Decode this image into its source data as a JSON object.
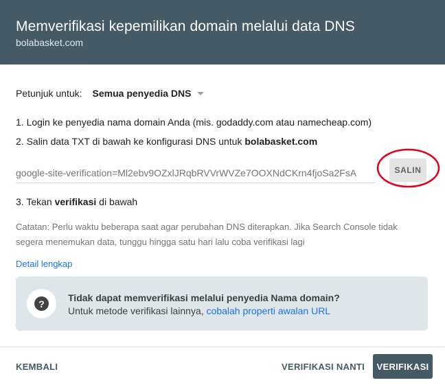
{
  "header": {
    "title": "Memverifikasi kepemilikan domain melalui data DNS",
    "domain": "bolabasket.com"
  },
  "instructions": {
    "label": "Petunjuk untuk:",
    "selected_provider": "Semua penyedia DNS"
  },
  "steps": {
    "step1": "1. Login ke penyedia nama domain Anda (mis. godaddy.com atau namecheap.com)",
    "step2_prefix": "2. Salin data TXT di bawah ke konfigurasi DNS untuk ",
    "step2_domain": "bolabasket.com",
    "step3_prefix": "3. Tekan ",
    "step3_bold": "verifikasi",
    "step3_suffix": " di bawah"
  },
  "txt_record": "google-site-verification=Ml2ebv9OZxlJRqbRVVrWVZe7OOXNdCKrn4fjoSa2FsA",
  "copy_button": "SALIN",
  "note": {
    "line1": "Catatan: Perlu waktu beberapa saat agar perubahan DNS diterapkan. Jika Search Console tidak",
    "line2": "segera menemukan data, tunggu hingga satu hari lalu coba verifikasi lagi"
  },
  "detail_link": "Detail lengkap",
  "help_box": {
    "title": "Tidak dapat memverifikasi melalui penyedia Nama domain?",
    "sub_prefix": "Untuk metode verifikasi lainnya, ",
    "sub_link": "cobalah properti awalan URL"
  },
  "footer": {
    "back": "KEMBALI",
    "verify_later": "VERIFIKASI NANTI",
    "verify": "VERIFIKASI"
  },
  "colors": {
    "header_bg": "#455a64",
    "link": "#1a73e8",
    "annotation_ring": "#e0001b"
  }
}
